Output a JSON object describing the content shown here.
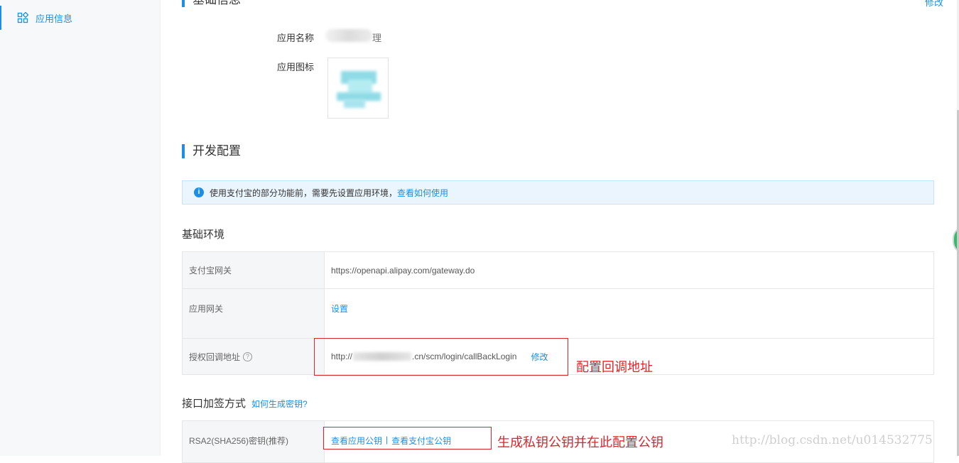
{
  "sidebar": {
    "items": [
      {
        "label": "应用信息",
        "icon": "apps-icon",
        "active": true
      }
    ]
  },
  "basic_info": {
    "title": "基础信息",
    "edit_label": "修改",
    "app_name_label": "应用名称",
    "app_name_value_tail": "理",
    "app_icon_label": "应用图标"
  },
  "dev_config": {
    "title": "开发配置",
    "notice": {
      "text": "使用支付宝的部分功能前，需要先设置应用环境，",
      "link": "查看如何使用"
    },
    "env_title": "基础环境",
    "rows": [
      {
        "label": "支付宝网关",
        "value": "https://openapi.alipay.com/gateway.do"
      },
      {
        "label": "应用网关",
        "link": "设置"
      },
      {
        "label": "授权回调地址",
        "url_prefix": "http://",
        "url_suffix": ".cn/scm/login/callBackLogin",
        "link": "修改"
      }
    ],
    "sign_title": "接口加签方式",
    "sign_help": "如何生成密钥?",
    "sign_row": {
      "label": "RSA2(SHA256)密钥(推荐)",
      "link1": "查看应用公钥",
      "separator": "|",
      "link2": "查看支付宝公钥"
    }
  },
  "annotations": {
    "callback": "配置回调地址",
    "keys": "生成私钥公钥并在此配置公钥",
    "color": "#d9262a"
  },
  "watermark": "http://blog.csdn.net/u014532775",
  "colors": {
    "accent": "#1b8fe6",
    "notice_bg": "#eaf5fe"
  }
}
